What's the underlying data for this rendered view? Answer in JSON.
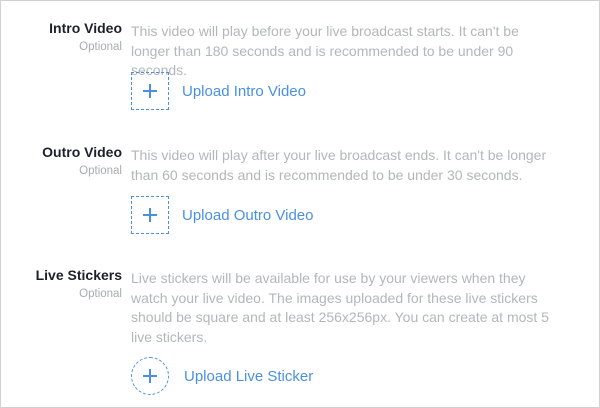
{
  "sections": [
    {
      "title": "Intro Video",
      "optional_label": "Optional",
      "description": "This video will play before your live broadcast starts. It can't be longer than 180 seconds and is recommended to be under 90 seconds.",
      "upload_label": "Upload Intro Video",
      "upload_icon": "plus-icon"
    },
    {
      "title": "Outro Video",
      "optional_label": "Optional",
      "description": "This video will play after your live broadcast ends. It can't be longer than 60 seconds and is recommended to be under 30 seconds.",
      "upload_label": "Upload Outro Video",
      "upload_icon": "plus-icon"
    },
    {
      "title": "Live Stickers",
      "optional_label": "Optional",
      "description": "Live stickers will be available for use by your viewers when they watch your live video. The images uploaded for these live stickers should be square and at least 256x256px. You can create at most 5 live stickers.",
      "upload_label": "Upload Live Sticker",
      "upload_icon": "plus-icon"
    }
  ],
  "colors": {
    "accent": "#4a90e2",
    "title": "#1d2129",
    "muted": "#b3b6bc",
    "border": "#d0d1d5"
  }
}
